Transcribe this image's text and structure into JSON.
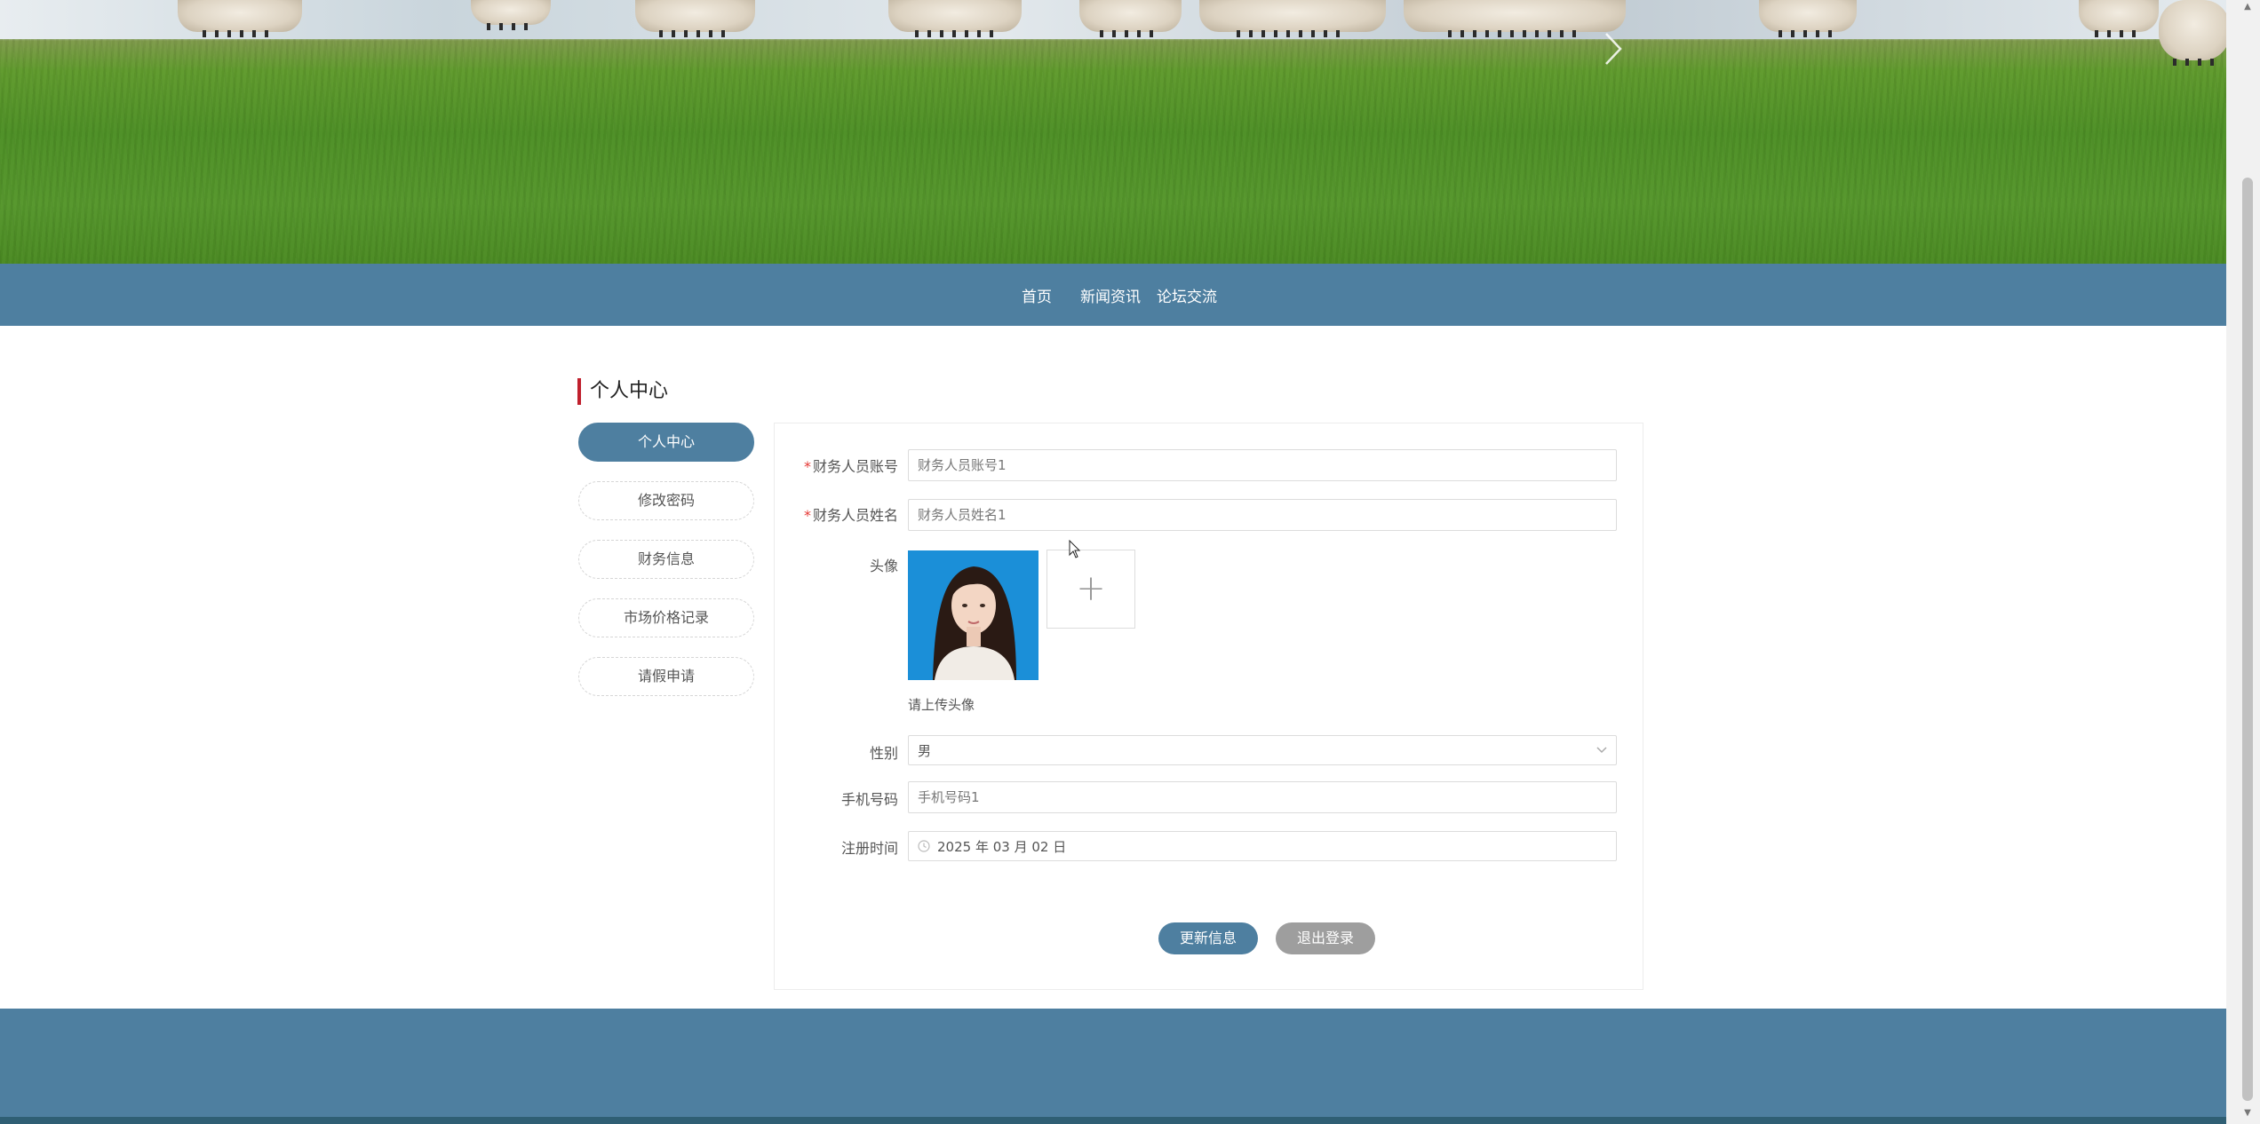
{
  "nav": {
    "items": [
      "首页",
      "新闻资讯",
      "论坛交流"
    ]
  },
  "section": {
    "title": "个人中心"
  },
  "sidebar": {
    "items": [
      {
        "label": "个人中心",
        "active": true
      },
      {
        "label": "修改密码",
        "active": false
      },
      {
        "label": "财务信息",
        "active": false
      },
      {
        "label": "市场价格记录",
        "active": false
      },
      {
        "label": "请假申请",
        "active": false
      }
    ]
  },
  "form": {
    "account": {
      "label": "财务人员账号",
      "required": "*",
      "placeholder": "财务人员账号1"
    },
    "name": {
      "label": "财务人员姓名",
      "required": "*",
      "placeholder": "财务人员姓名1"
    },
    "avatar": {
      "label": "头像",
      "hint": "请上传头像",
      "upload_symbol": "+"
    },
    "gender": {
      "label": "性别",
      "value": "男"
    },
    "phone": {
      "label": "手机号码",
      "placeholder": "手机号码1"
    },
    "register_time": {
      "label": "注册时间",
      "value": "2025 年 03 月 02 日"
    },
    "update_label": "更新信息",
    "logout_label": "退出登录"
  },
  "colors": {
    "primary": "#4e7fa0",
    "accent_bar": "#c0202d",
    "secondary_button": "#9e9e9e",
    "required": "#e53935"
  },
  "icons": {
    "carousel": "chevron-right-icon",
    "select": "chevron-down-icon",
    "date": "clock-icon",
    "upload": "plus-icon"
  }
}
